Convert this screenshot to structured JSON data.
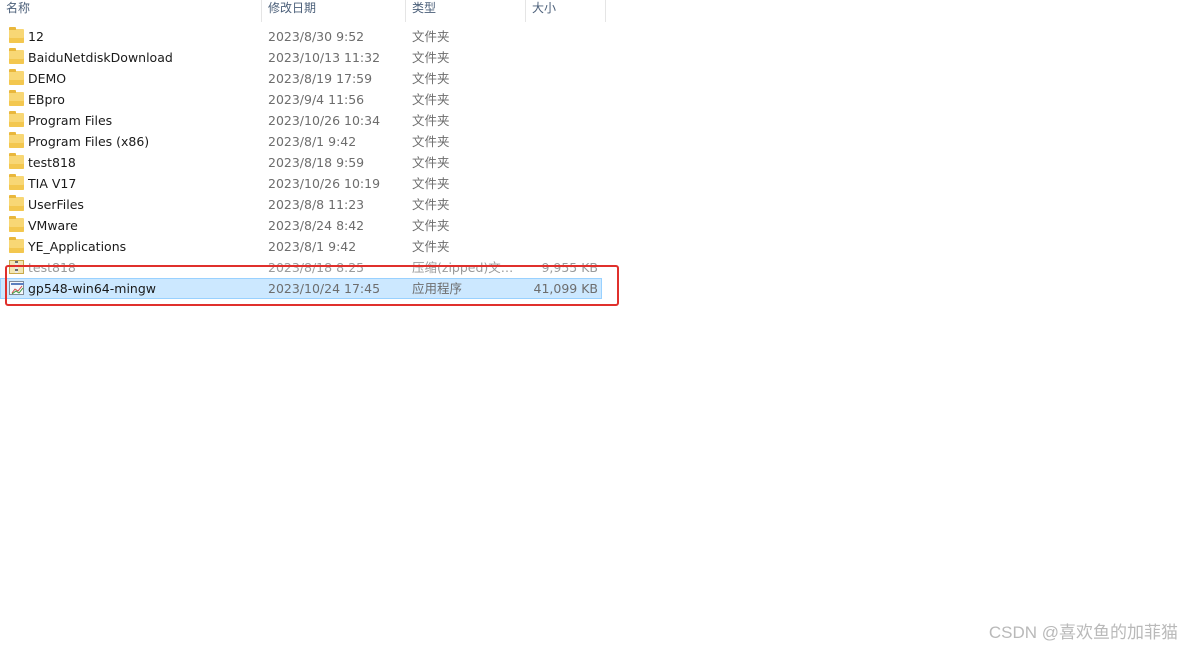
{
  "header": {
    "name": "名称",
    "date": "修改日期",
    "type": "类型",
    "size": "大小"
  },
  "files": [
    {
      "name": "12",
      "date": "2023/8/30 9:52",
      "type": "文件夹",
      "size": "",
      "icon": "folder-icon"
    },
    {
      "name": "BaiduNetdiskDownload",
      "date": "2023/10/13 11:32",
      "type": "文件夹",
      "size": "",
      "icon": "folder-icon"
    },
    {
      "name": "DEMO",
      "date": "2023/8/19 17:59",
      "type": "文件夹",
      "size": "",
      "icon": "folder-icon"
    },
    {
      "name": "EBpro",
      "date": "2023/9/4 11:56",
      "type": "文件夹",
      "size": "",
      "icon": "folder-icon"
    },
    {
      "name": "Program Files",
      "date": "2023/10/26 10:34",
      "type": "文件夹",
      "size": "",
      "icon": "folder-icon"
    },
    {
      "name": "Program Files (x86)",
      "date": "2023/8/1 9:42",
      "type": "文件夹",
      "size": "",
      "icon": "folder-icon"
    },
    {
      "name": "test818",
      "date": "2023/8/18 9:59",
      "type": "文件夹",
      "size": "",
      "icon": "folder-icon"
    },
    {
      "name": "TIA V17",
      "date": "2023/10/26 10:19",
      "type": "文件夹",
      "size": "",
      "icon": "folder-icon"
    },
    {
      "name": "UserFiles",
      "date": "2023/8/8 11:23",
      "type": "文件夹",
      "size": "",
      "icon": "folder-icon"
    },
    {
      "name": "VMware",
      "date": "2023/8/24 8:42",
      "type": "文件夹",
      "size": "",
      "icon": "folder-icon"
    },
    {
      "name": "YE_Applications",
      "date": "2023/8/1 9:42",
      "type": "文件夹",
      "size": "",
      "icon": "folder-icon"
    },
    {
      "name": "test818",
      "date": "2023/8/18 8:25",
      "type": "压缩(zipped)文件...",
      "size": "9,955 KB",
      "icon": "zip-icon"
    },
    {
      "name": "gp548-win64-mingw",
      "date": "2023/10/24 17:45",
      "type": "应用程序",
      "size": "41,099 KB",
      "icon": "app-icon"
    }
  ],
  "selected_index": 12,
  "highlight_color": "#e0302c",
  "selection_color": "#cce8ff",
  "watermark": "CSDN @喜欢鱼的加菲猫"
}
